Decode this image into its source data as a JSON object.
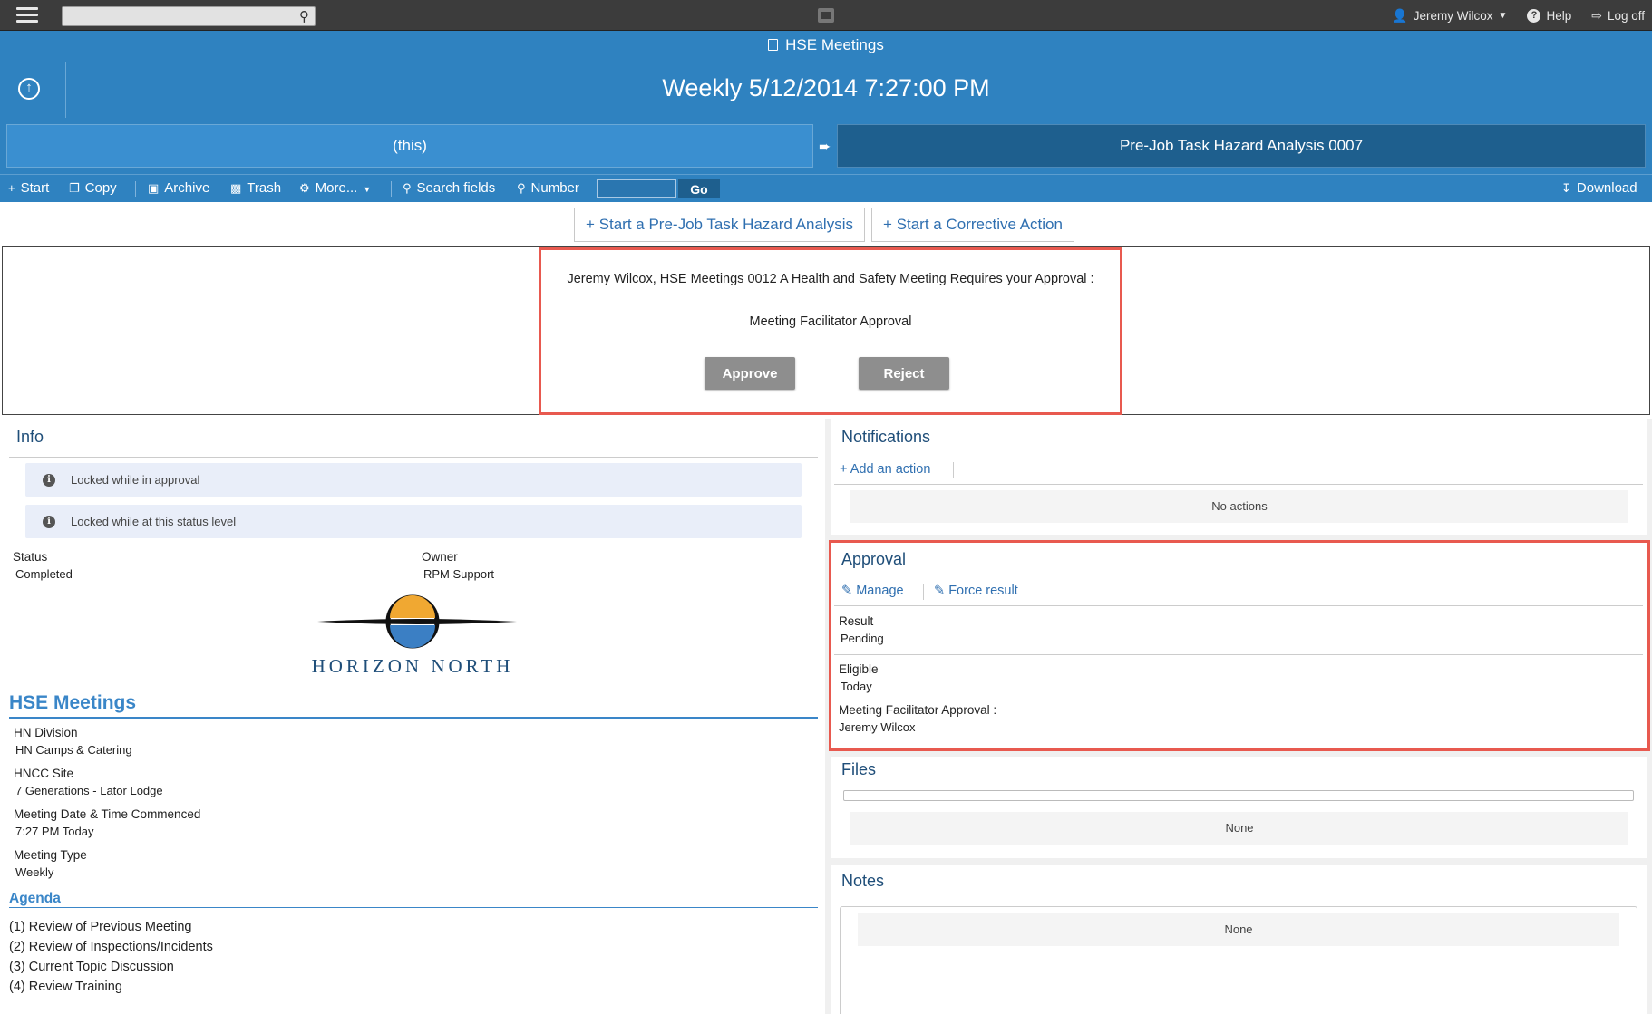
{
  "topbar": {
    "search_placeholder": "",
    "user_name": "Jeremy Wilcox",
    "help_label": "Help",
    "logoff_label": "Log off"
  },
  "header": {
    "breadcrumb": "HSE Meetings",
    "title": "Weekly 5/12/2014 7:27:00 PM"
  },
  "flow": {
    "current_label": "(this)",
    "next_label": "Pre-Job Task Hazard Analysis 0007"
  },
  "toolbar": {
    "start": "Start",
    "copy": "Copy",
    "archive": "Archive",
    "trash": "Trash",
    "more": "More...",
    "search_fields": "Search fields",
    "number": "Number",
    "number_value": "",
    "go": "Go",
    "download": "Download"
  },
  "start_actions": [
    "Start a Pre-Job Task Hazard Analysis",
    "Start a Corrective Action"
  ],
  "approval_banner": {
    "message": "Jeremy Wilcox, HSE Meetings 0012 A Health and Safety Meeting Requires your Approval :",
    "step": "Meeting Facilitator Approval",
    "approve": "Approve",
    "reject": "Reject"
  },
  "info": {
    "title": "Info",
    "notices": [
      "Locked while in approval",
      "Locked while at this status level"
    ],
    "status_label": "Status",
    "status_value": "Completed",
    "owner_label": "Owner",
    "owner_value": "RPM Support",
    "logo_text": "HORIZON NORTH"
  },
  "hse": {
    "title": "HSE Meetings",
    "fields": [
      {
        "label": "HN Division",
        "value": "HN Camps & Catering"
      },
      {
        "label": "HNCC Site",
        "value": "7 Generations - Lator Lodge"
      },
      {
        "label": "Meeting Date & Time Commenced",
        "value": "7:27 PM Today"
      },
      {
        "label": "Meeting Type",
        "value": "Weekly"
      }
    ],
    "agenda_title": "Agenda",
    "agenda": [
      "(1) Review of Previous Meeting",
      "(2) Review of Inspections/Incidents",
      "(3) Current Topic Discussion",
      "(4) Review Training"
    ]
  },
  "notifications": {
    "title": "Notifications",
    "add_action": "Add an action",
    "empty": "No actions"
  },
  "approval": {
    "title": "Approval",
    "manage": "Manage",
    "force_result": "Force result",
    "result_label": "Result",
    "result_value": "Pending",
    "eligible_label": "Eligible",
    "eligible_value": "Today",
    "facilitator_label": "Meeting Facilitator Approval :",
    "facilitator_value": "Jeremy Wilcox"
  },
  "files": {
    "title": "Files",
    "empty": "None"
  },
  "notes": {
    "title": "Notes",
    "empty": "None"
  },
  "colors": {
    "header_blue": "#2f82c0",
    "dark_blue": "#1e5f8e",
    "highlight_red": "#e8594f",
    "accent_blue": "#3a86c8"
  }
}
